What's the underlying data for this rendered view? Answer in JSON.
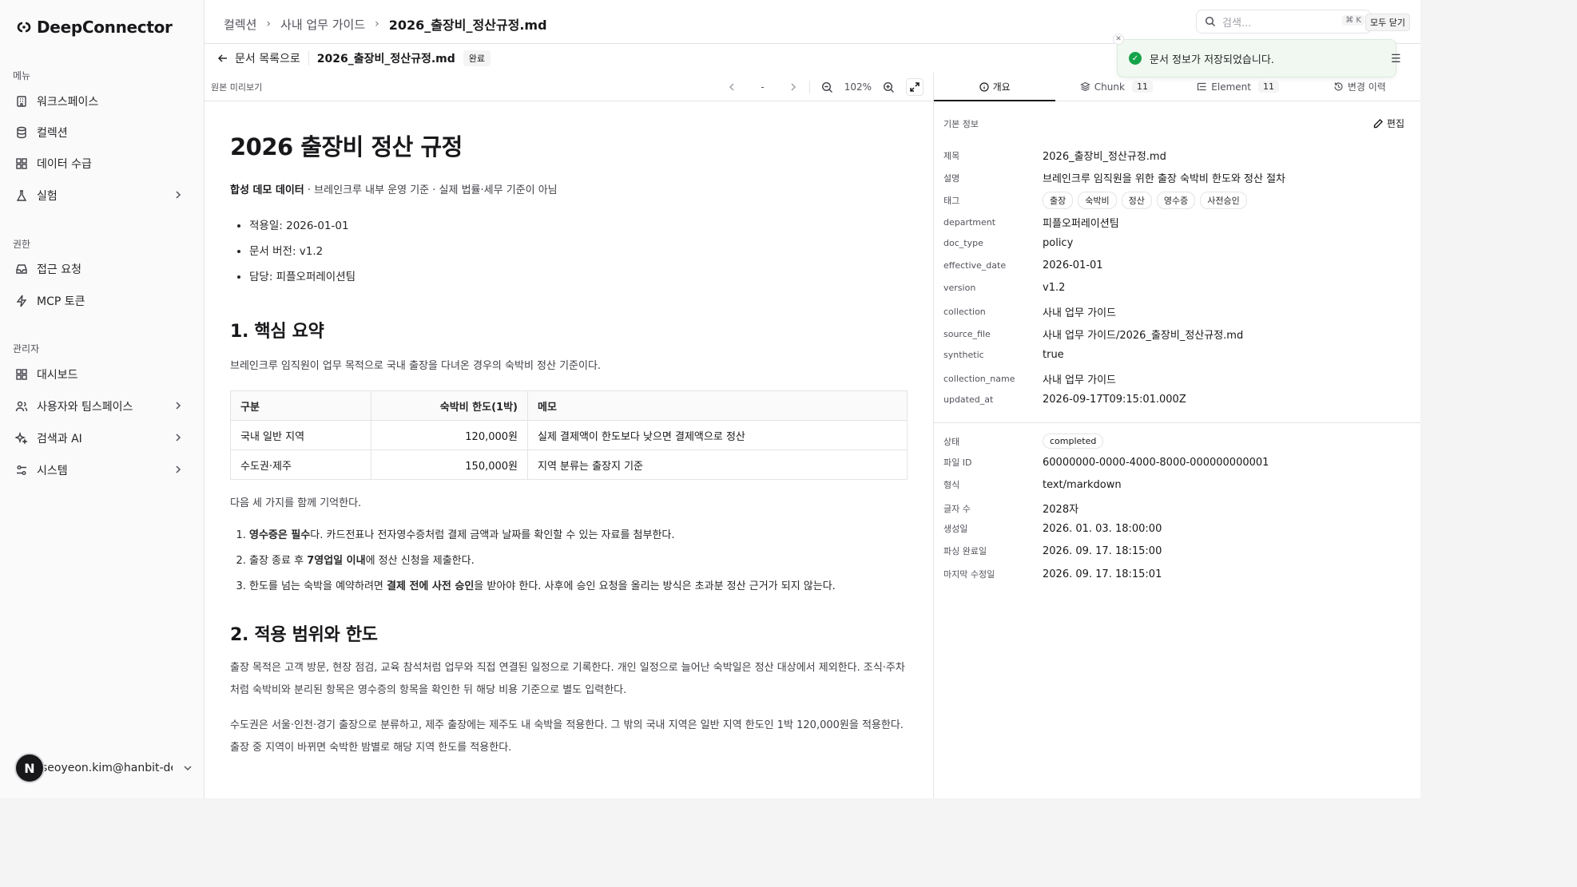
{
  "app": {
    "brand": "DeepConnector"
  },
  "sidebar": {
    "sections": [
      {
        "label": "메뉴"
      },
      {
        "label": "권한"
      },
      {
        "label": "관리자"
      }
    ],
    "items": [
      {
        "label": "워크스페이스",
        "icon": "building-icon"
      },
      {
        "label": "컬렉션",
        "icon": "database-icon"
      },
      {
        "label": "데이터 수급",
        "icon": "grid-icon"
      },
      {
        "label": "실험",
        "icon": "flask-icon",
        "has_submenu": true
      },
      {
        "label": "접근 요청",
        "icon": "inbox-icon"
      },
      {
        "label": "MCP 토큰",
        "icon": "bolt-icon"
      },
      {
        "label": "대시보드",
        "icon": "grid-icon"
      },
      {
        "label": "사용자와 팀스페이스",
        "icon": "users-icon",
        "has_submenu": true
      },
      {
        "label": "검색과 AI",
        "icon": "sparkle-icon",
        "has_submenu": true
      },
      {
        "label": "시스템",
        "icon": "settings-sliders-icon",
        "has_submenu": true
      }
    ],
    "user": {
      "initial": "N",
      "email": "seoyeon.kim@hanbit-de..."
    }
  },
  "header": {
    "breadcrumbs": [
      "컬렉션",
      "사내 업무 가이드",
      "2026_출장비_정산규정.md"
    ],
    "search_placeholder": "검색...",
    "search_shortcut": "⌘ K",
    "dismiss_all": "모두 닫기"
  },
  "toast": {
    "message": "문서 정보가 저장되었습니다."
  },
  "subbar": {
    "back_label": "문서 목록으로",
    "doc_name": "2026_출장비_정산규정.md",
    "badge": "완료"
  },
  "preview": {
    "title": "원본 미리보기",
    "page": "-",
    "zoom": "102%"
  },
  "document": {
    "h1": "2026 출장비 정산 규정",
    "intro_bold": "합성 데모 데이터",
    "intro_rest": " · 브레인크루 내부 운영 기준 · 실제 법률·세무 기준이 아님",
    "meta_list": [
      "적용일: 2026-01-01",
      "문서 버전: v1.2",
      "담당: 피플오퍼레이션팀"
    ],
    "s1_title": "1. 핵심 요약",
    "s1_para": "브레인크루 임직원이 업무 목적으로 국내 출장을 다녀온 경우의 숙박비 정산 기준이다.",
    "table": {
      "headers": [
        "구분",
        "숙박비 한도(1박)",
        "메모"
      ],
      "rows": [
        [
          "국내 일반 지역",
          "120,000원",
          "실제 결제액이 한도보다 낮으면 결제액으로 정산"
        ],
        [
          "수도권·제주",
          "150,000원",
          "지역 분류는 출장지 기준"
        ]
      ]
    },
    "s1_after": "다음 세 가지를 함께 기억한다.",
    "rules": [
      {
        "bold": "영수증은 필수",
        "pre": "",
        "post": "다. 카드전표나 전자영수증처럼 결제 금액과 날짜를 확인할 수 있는 자료를 첨부한다."
      },
      {
        "pre": "출장 종료 후 ",
        "bold": "7영업일 이내",
        "post": "에 정산 신청을 제출한다."
      },
      {
        "pre": "한도를 넘는 숙박을 예약하려면 ",
        "bold": "결제 전에 사전 승인",
        "post": "을 받아야 한다. 사후에 승인 요청을 올리는 방식은 초과분 정산 근거가 되지 않는다."
      }
    ],
    "s2_title": "2. 적용 범위와 한도",
    "s2_p1": "출장 목적은 고객 방문, 현장 점검, 교육 참석처럼 업무와 직접 연결된 일정으로 기록한다. 개인 일정으로 늘어난 숙박일은 정산 대상에서 제외한다. 조식·주차처럼 숙박비와 분리된 항목은 영수증의 항목을 확인한 뒤 해당 비용 기준으로 별도 입력한다.",
    "s2_p2": "수도권은 서울·인천·경기 출장으로 분류하고, 제주 출장에는 제주도 내 숙박을 적용한다. 그 밖의 국내 지역은 일반 지역 한도인 1박 120,000원을 적용한다. 출장 중 지역이 바뀌면 숙박한 밤별로 해당 지역 한도를 적용한다."
  },
  "panel": {
    "tabs": [
      {
        "label": "개요",
        "icon": "info-icon"
      },
      {
        "label": "Chunk",
        "icon": "layers-icon",
        "count": "11"
      },
      {
        "label": "Element",
        "icon": "list-tree-icon",
        "count": "11"
      },
      {
        "label": "변경 이력",
        "icon": "history-icon"
      }
    ],
    "section_title": "기본 정보",
    "edit_label": "편집",
    "fields": [
      {
        "k": "제목",
        "v": "2026_출장비_정산규정.md"
      },
      {
        "k": "설명",
        "v": "브레인크루 임직원을 위한 출장 숙박비 한도와 정산 절차"
      },
      {
        "k": "태그",
        "tags": [
          "출장",
          "숙박비",
          "정산",
          "영수증",
          "사전승인"
        ]
      },
      {
        "k": "department",
        "v": "피플오퍼레이션팀"
      },
      {
        "k": "doc_type",
        "v": "policy"
      },
      {
        "k": "effective_date",
        "v": "2026-01-01"
      },
      {
        "k": "version",
        "v": "v1.2"
      },
      {
        "k": "collection",
        "v": "사내 업무 가이드"
      },
      {
        "k": "source_file",
        "v": "사내 업무 가이드/2026_출장비_정산규정.md"
      },
      {
        "k": "synthetic",
        "v": "true"
      },
      {
        "k": "collection_name",
        "v": "사내 업무 가이드"
      },
      {
        "k": "updated_at",
        "v": "2026-09-17T09:15:01.000Z"
      }
    ],
    "system_fields": [
      {
        "k": "상태",
        "v": "completed",
        "pill": true
      },
      {
        "k": "파일 ID",
        "v": "60000000-0000-4000-8000-000000000001"
      },
      {
        "k": "형식",
        "v": "text/markdown"
      },
      {
        "k": "글자 수",
        "v": "2028자"
      },
      {
        "k": "생성일",
        "v": "2026. 01. 03. 18:00:00"
      },
      {
        "k": "파싱 완료일",
        "v": "2026. 09. 17. 18:15:00"
      },
      {
        "k": "마지막 수정일",
        "v": "2026. 09. 17. 18:15:01"
      }
    ]
  }
}
